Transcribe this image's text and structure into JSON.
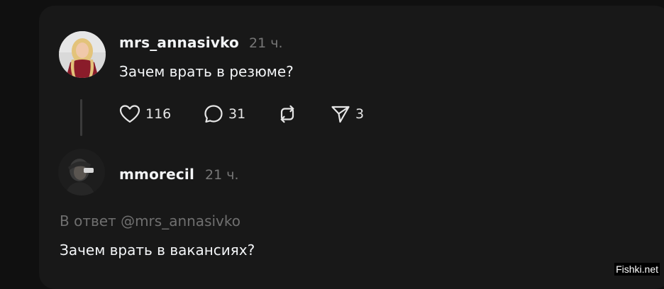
{
  "post": {
    "username": "mrs_annasivko",
    "time": "21 ч.",
    "text": "Зачем врать в резюме?",
    "avatar_icon": "avatar-woman-photo",
    "actions": {
      "likes": {
        "icon": "heart-icon",
        "count": "116"
      },
      "comments": {
        "icon": "comment-icon",
        "count": "31"
      },
      "repost": {
        "icon": "repost-icon",
        "count": ""
      },
      "share": {
        "icon": "send-icon",
        "count": "3"
      }
    }
  },
  "reply": {
    "username": "mmorecil",
    "time": "21 ч.",
    "avatar_icon": "avatar-man-photo",
    "reply_prefix": "В ответ",
    "reply_mention": "@mrs_annasivko",
    "text": "Зачем врать в вакансиях?"
  },
  "watermark": "Fishki.net",
  "colors": {
    "background": "#101010",
    "card": "#181818",
    "text_primary": "#f3f5f7",
    "text_secondary": "#777777"
  }
}
